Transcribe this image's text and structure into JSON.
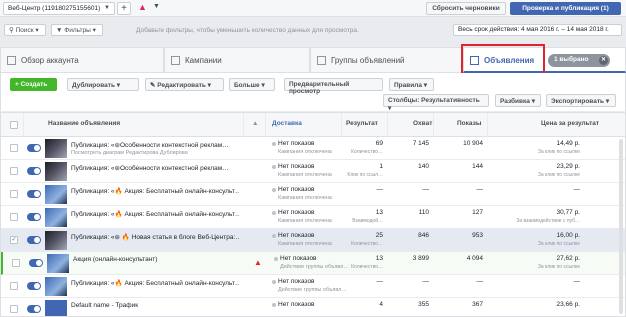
{
  "topbar": {
    "account": "Веб-Центр (119180275155601)",
    "drafts_btn": "Сбросить черновики",
    "review_btn": "Проверка и публикация (1)"
  },
  "filterbar": {
    "search": "Поиск",
    "filters": "Фильтры",
    "hint": "Добавьте фильтры, чтобы уменьшить количество данных для просмотра.",
    "date_range": "Весь срок действия: 4 мая 2016 г. – 14 мая 2018 г."
  },
  "tabs": {
    "accounts": "Обзор аккаунта",
    "campaigns": "Кампании",
    "adsets": "Группы объявлений",
    "ads": "Объявления",
    "selected": "1 выбрано"
  },
  "toolbar": {
    "create": "+ Создать",
    "duplicate": "Дублировать",
    "edit": "Редактировать",
    "more": "Больше",
    "preview": "Предварительный просмотр",
    "rules": "Правила",
    "columns": "Столбцы: Результативность",
    "breakdown": "Разбивка",
    "export": "Экспортировать"
  },
  "table": {
    "headers": {
      "name": "Название объявления",
      "delivery": "Доставка",
      "results": "Результат",
      "reach": "Охват",
      "impressions": "Показы",
      "cost": "Цена за результат"
    },
    "rows": [
      {
        "name": "Публикация: «⊜Особенности контекстной реклам…",
        "sub": "Посмотреть диаграм   Редактирова   Дублирова",
        "delivery": "Нет показов",
        "delivery_sub": "Кампания отключена",
        "results": "69",
        "results_sub": "Количество…",
        "reach": "7 145",
        "impressions": "10 904",
        "cost": "14,49 р.",
        "cost_sub": "За клик по ссылке"
      },
      {
        "name": "Публикация: «⊜Особенности контекстной реклам…",
        "sub": "",
        "delivery": "Нет показов",
        "delivery_sub": "Кампания отключена",
        "results": "1",
        "results_sub": "Клик по ссыл…",
        "reach": "140",
        "impressions": "144",
        "cost": "23,29 р.",
        "cost_sub": "За клик по ссылке"
      },
      {
        "name": "Публикация: «🔥 Акция: Бесплатный онлайн-консульт…",
        "sub": "",
        "delivery": "Нет показов",
        "delivery_sub": "Кампания отключена",
        "results": "—",
        "results_sub": "",
        "reach": "—",
        "impressions": "—",
        "cost": "—",
        "cost_sub": ""
      },
      {
        "name": "Публикация: «🔥 Акция: Бесплатный онлайн-консульт…",
        "sub": "",
        "delivery": "Нет показов",
        "delivery_sub": "Кампания отключена",
        "results": "13",
        "results_sub": "Взаимодей…",
        "reach": "110",
        "impressions": "127",
        "cost": "30,77 р.",
        "cost_sub": "За взаимодействие с пуб…"
      },
      {
        "name": "Публикация: «⊜ 🔥 Новая статья в блоге Веб-Центра:…",
        "sub": "",
        "delivery": "Нет показов",
        "delivery_sub": "Кампания отключена",
        "results": "25",
        "results_sub": "Количество…",
        "reach": "846",
        "impressions": "953",
        "cost": "16,00 р.",
        "cost_sub": "За клик по ссылке"
      },
      {
        "name": "Акция (онлайн-консультант)",
        "sub": "",
        "delivery": "Нет показов",
        "delivery_sub": "Действие группы объявл…",
        "results": "13",
        "results_sub": "Количество…",
        "reach": "3 899",
        "impressions": "4 094",
        "cost": "27,62 р.",
        "cost_sub": "За клик по ссылке"
      },
      {
        "name": "Публикация: «🔥 Акция: Бесплатный онлайн-консульт…",
        "sub": "",
        "delivery": "Нет показов",
        "delivery_sub": "Действие группы объявл…",
        "results": "—",
        "results_sub": "",
        "reach": "—",
        "impressions": "—",
        "cost": "—",
        "cost_sub": ""
      },
      {
        "name": "Default name - Трафик",
        "sub": "",
        "delivery": "Нет показов",
        "delivery_sub": "",
        "results": "4",
        "results_sub": "",
        "reach": "355",
        "impressions": "367",
        "cost": "23,66 р.",
        "cost_sub": ""
      }
    ]
  }
}
